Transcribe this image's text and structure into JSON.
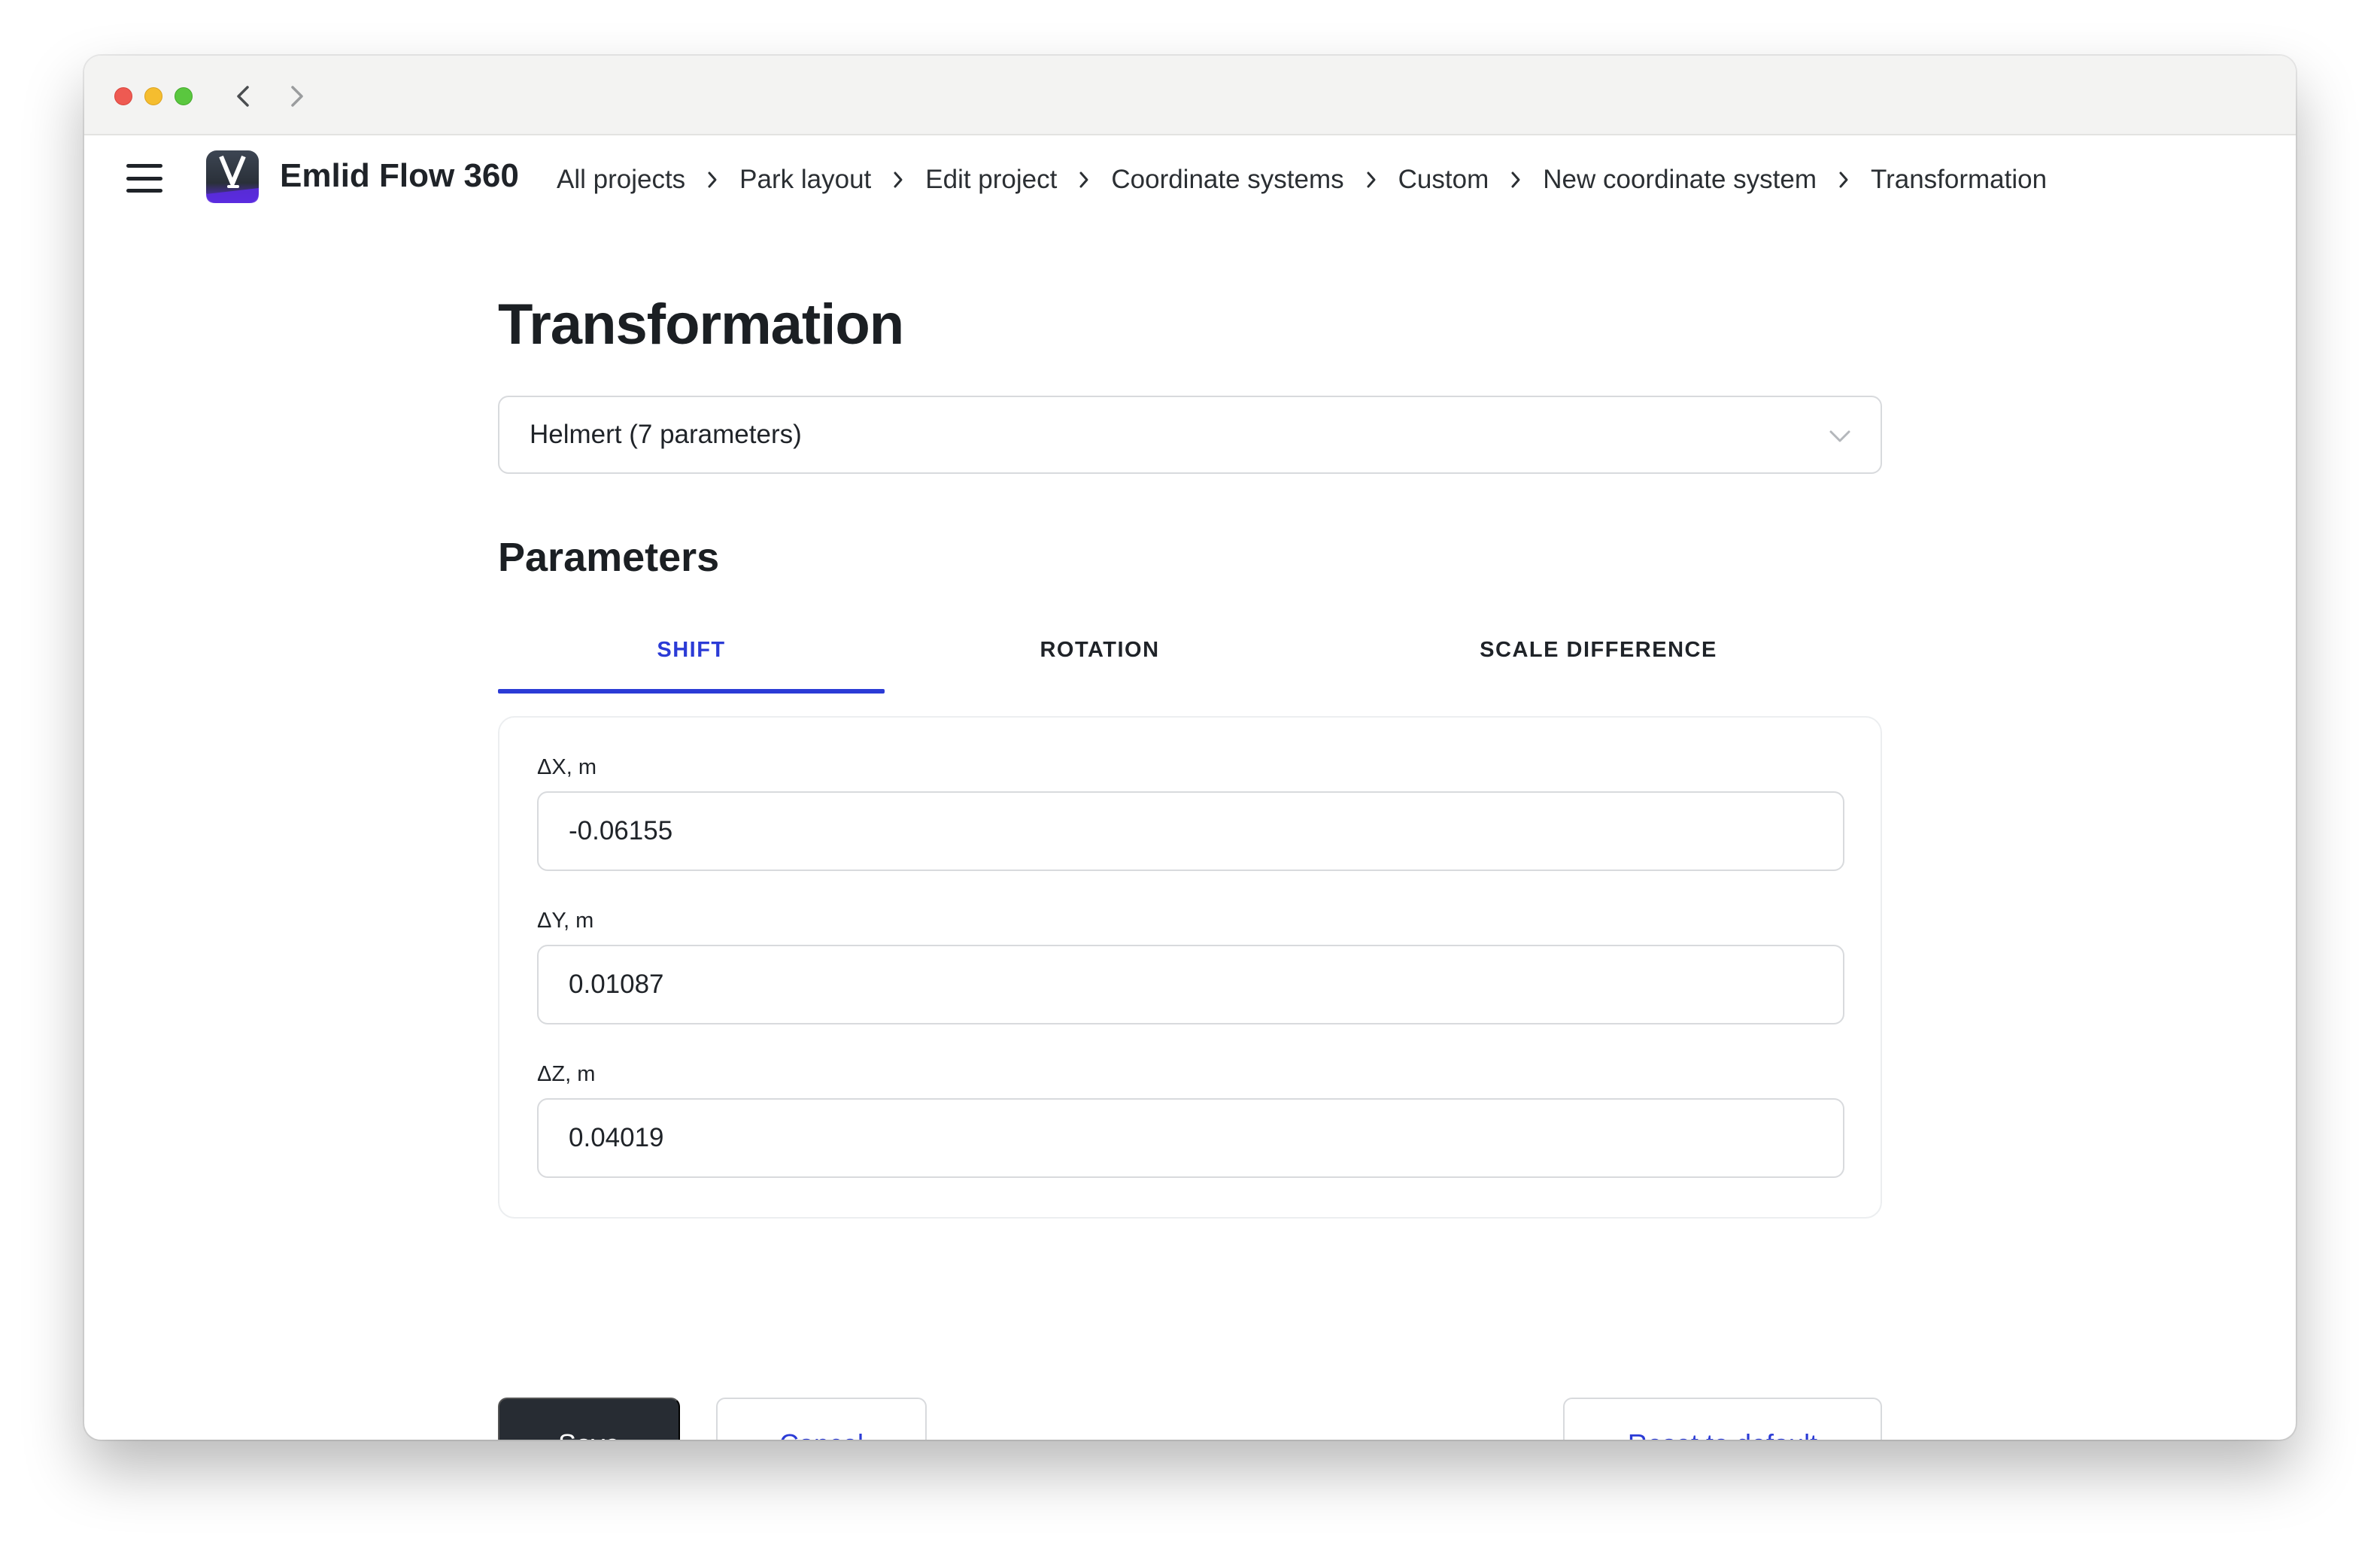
{
  "app": {
    "name": "Emlid Flow 360",
    "logo_icon": "emlid-flow-logo-icon"
  },
  "breadcrumb": [
    "All projects",
    "Park layout",
    "Edit project",
    "Coordinate systems",
    "Custom",
    "New coordinate system",
    "Transformation"
  ],
  "page": {
    "title": "Transformation",
    "transformation_type": "Helmert (7 parameters)",
    "parameters_title": "Parameters"
  },
  "tabs": [
    {
      "label": "SHIFT",
      "active": true
    },
    {
      "label": "ROTATION",
      "active": false
    },
    {
      "label": "SCALE DIFFERENCE",
      "active": false
    }
  ],
  "fields": [
    {
      "label": "ΔX, m",
      "value": "-0.06155"
    },
    {
      "label": "ΔY, m",
      "value": "0.01087"
    },
    {
      "label": "ΔZ, m",
      "value": "0.04019"
    }
  ],
  "actions": {
    "save": "Save",
    "cancel": "Cancel",
    "reset": "Reset to default"
  },
  "colors": {
    "accent": "#2b3bd6",
    "primary_button": "#272c33",
    "traffic_red": "#ee5a52",
    "traffic_yellow": "#f5bd2f",
    "traffic_green": "#5ac73f"
  }
}
